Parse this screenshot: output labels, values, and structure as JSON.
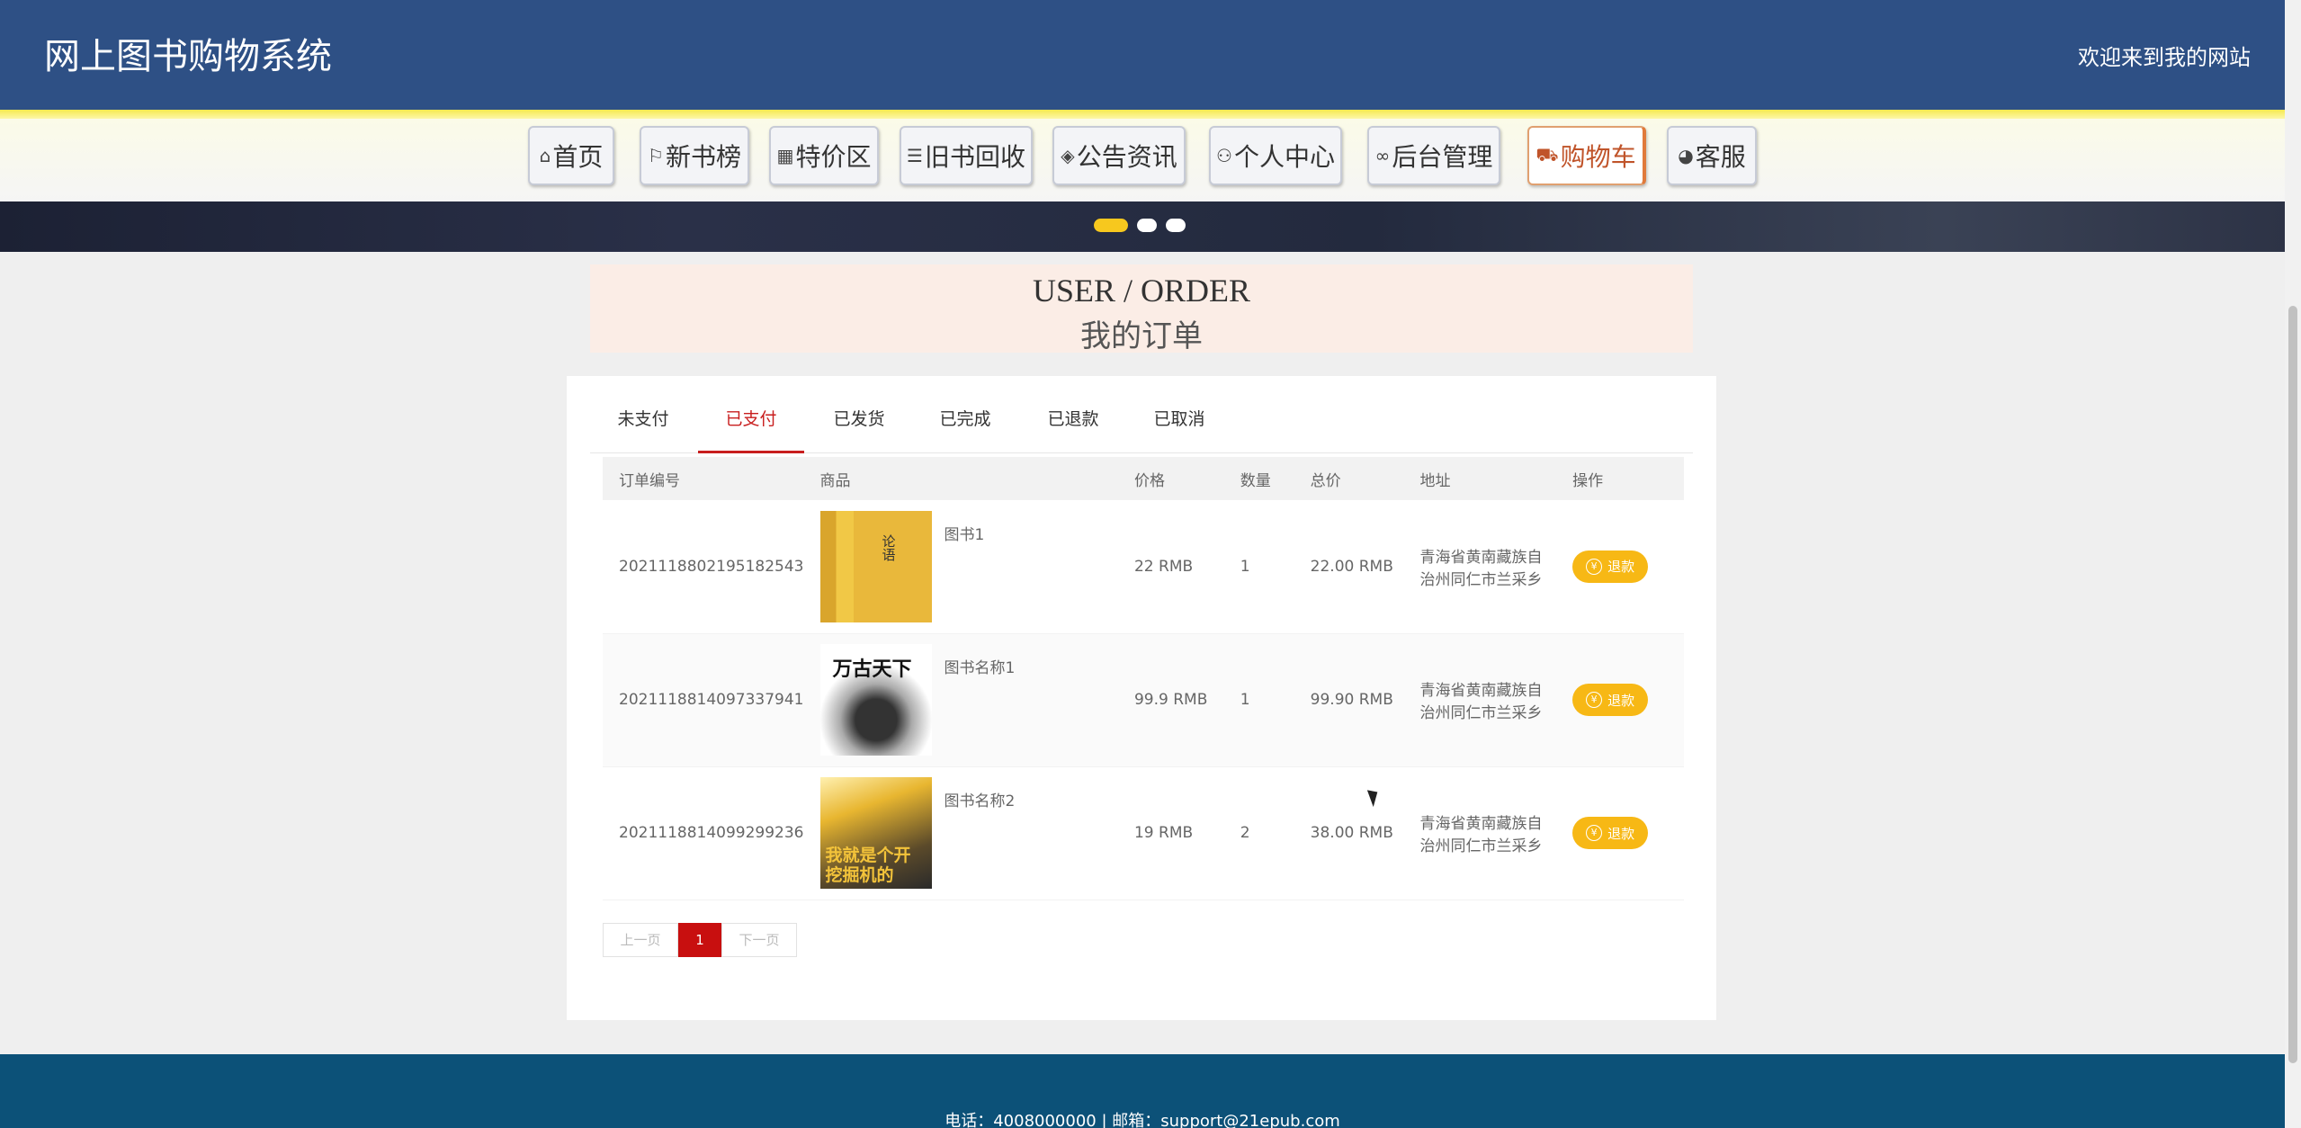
{
  "header": {
    "title": "网上图书购物系统",
    "welcome": "欢迎来到我的网站"
  },
  "nav": {
    "items": [
      {
        "icon": "home-icon",
        "glyph": "⌂",
        "label": "首页"
      },
      {
        "icon": "flag-icon",
        "glyph": "⚐",
        "label": "新书榜"
      },
      {
        "icon": "grid-icon",
        "glyph": "▦",
        "label": "特价区"
      },
      {
        "icon": "sliders-icon",
        "glyph": "☰",
        "label": "旧书回收"
      },
      {
        "icon": "layers-icon",
        "glyph": "◈",
        "label": "公告资讯"
      },
      {
        "icon": "user-icon",
        "glyph": "⚇",
        "label": "个人中心"
      },
      {
        "icon": "link-icon",
        "glyph": "∞",
        "label": "后台管理"
      },
      {
        "icon": "cart-icon",
        "glyph": "⛟",
        "label": "购物车"
      },
      {
        "icon": "support-icon",
        "glyph": "◕",
        "label": "客服"
      }
    ],
    "active": "购物车"
  },
  "order_head": {
    "en": "USER / ORDER",
    "cn": "我的订单"
  },
  "tabs": [
    "未支付",
    "已支付",
    "已发货",
    "已完成",
    "已退款",
    "已取消"
  ],
  "active_tab": "已支付",
  "table": {
    "headers": [
      "订单编号",
      "商品",
      "价格",
      "数量",
      "总价",
      "地址",
      "操作"
    ],
    "rows": [
      {
        "order_no": "2021118802195182543",
        "name": "图书1",
        "price": "22 RMB",
        "qty": "1",
        "total": "22.00 RMB",
        "address": "青海省黄南藏族自治州同仁市兰采乡",
        "action": "退款"
      },
      {
        "order_no": "2021118814097337941",
        "name": "图书名称1",
        "price": "99.9 RMB",
        "qty": "1",
        "total": "99.90 RMB",
        "address": "青海省黄南藏族自治州同仁市兰采乡",
        "action": "退款"
      },
      {
        "order_no": "2021118814099299236",
        "name": "图书名称2",
        "price": "19 RMB",
        "qty": "2",
        "total": "38.00 RMB",
        "address": "青海省黄南藏族自治州同仁市兰采乡",
        "action": "退款"
      }
    ]
  },
  "pager": {
    "prev": "上一页",
    "current": "1",
    "next": "下一页"
  },
  "footer": {
    "info": "电话：4008000000 | 邮箱：support@21epub.com"
  },
  "colors": {
    "header_bg": "#2e5085",
    "accent_red": "#c81e1e",
    "refund_yellow": "#f7b815",
    "footer_bg": "#0c5178"
  }
}
